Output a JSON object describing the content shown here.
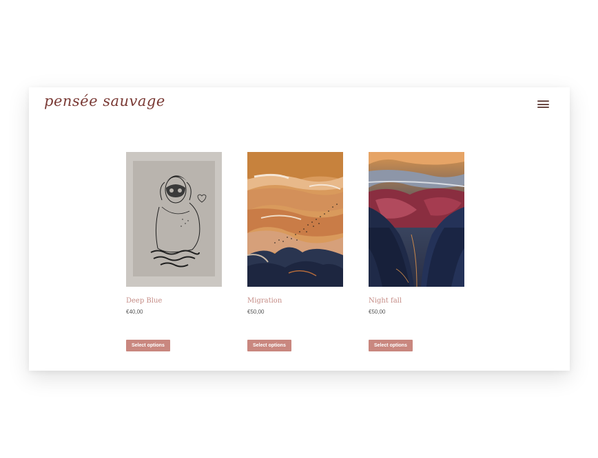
{
  "header": {
    "logo_text": "pensée sauvage",
    "menu_icon": "hamburger-icon"
  },
  "products": [
    {
      "name": "Deep Blue",
      "price": "€40,00",
      "button_label": "Select options"
    },
    {
      "name": "Migration",
      "price": "€50,00",
      "button_label": "Select options"
    },
    {
      "name": "Night fall",
      "price": "€50,00",
      "button_label": "Select options"
    }
  ],
  "colors": {
    "brand": "#7a3a35",
    "product_name": "#c58c86",
    "button_bg": "#c9877f"
  }
}
